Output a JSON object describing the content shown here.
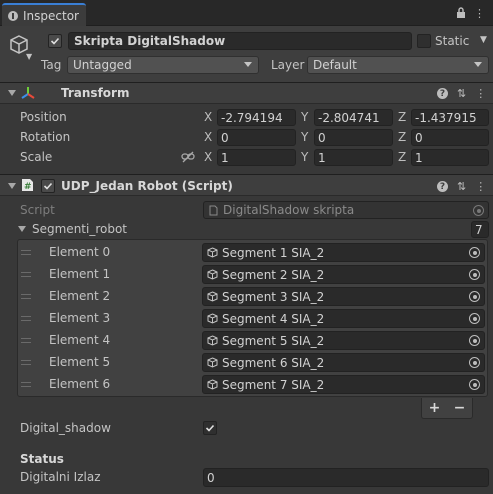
{
  "tab": {
    "title": "Inspector"
  },
  "gameobject": {
    "name": "Skripta DigitalShadow",
    "static_label": "Static",
    "tag_label": "Tag",
    "tag_value": "Untagged",
    "layer_label": "Layer",
    "layer_value": "Default"
  },
  "transform": {
    "title": "Transform",
    "position": {
      "label": "Position",
      "x": "-2.794194",
      "y": "-2.804741",
      "z": "-1.437915"
    },
    "rotation": {
      "label": "Rotation",
      "x": "0",
      "y": "0",
      "z": "0"
    },
    "scale": {
      "label": "Scale",
      "x": "1",
      "y": "1",
      "z": "1"
    },
    "axes": {
      "x": "X",
      "y": "Y",
      "z": "Z"
    }
  },
  "script_component": {
    "title": "UDP_Jedan Robot (Script)",
    "script_label": "Script",
    "script_value": "DigitalShadow skripta",
    "list_label": "Segmenti_robot",
    "list_count": "7",
    "elements": [
      {
        "label": "Element 0",
        "value": "Segment 1 SIA_2"
      },
      {
        "label": "Element 1",
        "value": "Segment 2 SIA_2"
      },
      {
        "label": "Element 2",
        "value": "Segment 3 SIA_2"
      },
      {
        "label": "Element 3",
        "value": "Segment 4 SIA_2"
      },
      {
        "label": "Element 4",
        "value": "Segment 5 SIA_2"
      },
      {
        "label": "Element 5",
        "value": "Segment 6 SIA_2"
      },
      {
        "label": "Element 6",
        "value": "Segment 7 SIA_2"
      }
    ],
    "plus": "+",
    "minus": "−",
    "digital_shadow_label": "Digital_shadow",
    "digital_shadow_checked": true,
    "status_header": "Status",
    "digitalni_izlaz_label": "Digitalni Izlaz",
    "digitalni_izlaz_value": "0"
  },
  "colors": {
    "accent": "#3a7fd5",
    "background": "#383838",
    "field": "#2a2a2a"
  }
}
